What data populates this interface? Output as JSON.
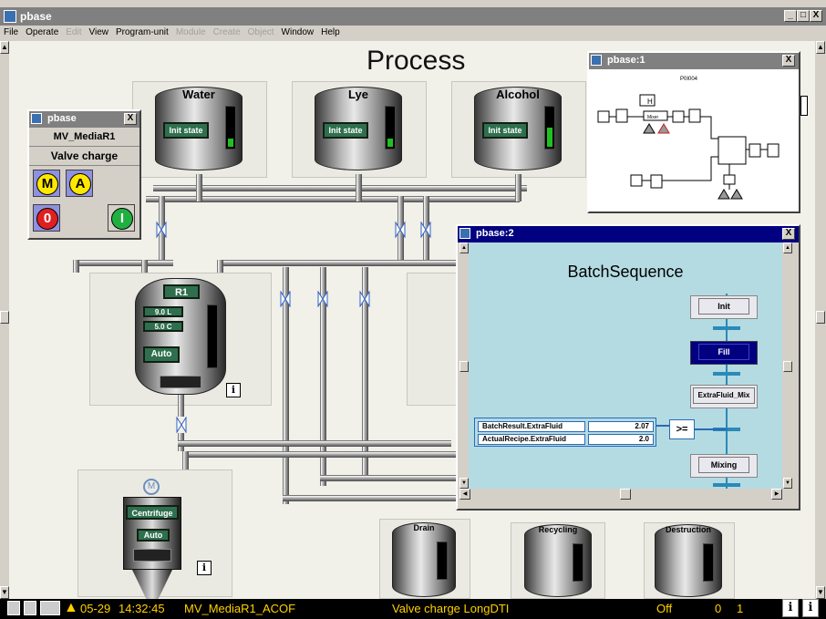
{
  "window": {
    "title": "pbase",
    "min": "_",
    "max": "□",
    "close": "X"
  },
  "menu": [
    {
      "label": "File",
      "enabled": true
    },
    {
      "label": "Operate",
      "enabled": true
    },
    {
      "label": "Edit",
      "enabled": false
    },
    {
      "label": "View",
      "enabled": true
    },
    {
      "label": "Program-unit",
      "enabled": true
    },
    {
      "label": "Module",
      "enabled": false
    },
    {
      "label": "Create",
      "enabled": false
    },
    {
      "label": "Object",
      "enabled": false
    },
    {
      "label": "Window",
      "enabled": true
    },
    {
      "label": "Help",
      "enabled": true
    }
  ],
  "process": {
    "title": "Process",
    "tanks": [
      {
        "label": "Water",
        "state": "Init state",
        "level": 0.2
      },
      {
        "label": "Lye",
        "state": "Init state",
        "level": 0.2
      },
      {
        "label": "Alcohol",
        "state": "Init state",
        "level": 0.45
      }
    ],
    "reactor": {
      "name": "R1",
      "volume": "9.0 L",
      "temp": "5.0 C",
      "mode": "Auto"
    },
    "centrifuge": {
      "name": "Centrifuge",
      "mode": "Auto"
    },
    "outputs": [
      "Drain",
      "Recycling",
      "Destruction"
    ],
    "motor_symbol": "M"
  },
  "faceplate": {
    "title": "pbase",
    "close": "X",
    "name": "MV_MediaR1",
    "function": "Valve charge",
    "btn_manual": "M",
    "btn_auto": "A",
    "btn_off": "0",
    "btn_on": "I"
  },
  "pbase1": {
    "title": "pbase:1",
    "close": "X",
    "diagram_label": "P0I004",
    "node_mixer": "Mixer",
    "node_h": "H"
  },
  "pbase2": {
    "title": "pbase:2",
    "close": "X",
    "heading": "BatchSequence",
    "steps": [
      {
        "label": "Init",
        "active": false
      },
      {
        "label": "Fill",
        "active": true
      },
      {
        "label": "ExtraFluid_Mix",
        "active": false
      },
      {
        "label": "Mixing",
        "active": false
      }
    ],
    "condition": {
      "rows": [
        {
          "name": "BatchResult.ExtraFluid",
          "value": "2.07"
        },
        {
          "name": "ActualRecipe.ExtraFluid",
          "value": "2.0"
        }
      ],
      "operator": ">="
    }
  },
  "status": {
    "date": "05-29",
    "time": "14:32:45",
    "object": "MV_MediaR1_ACOF",
    "text": "Valve charge LongDTI",
    "state": "Off",
    "v1": "0",
    "v2": "1"
  }
}
